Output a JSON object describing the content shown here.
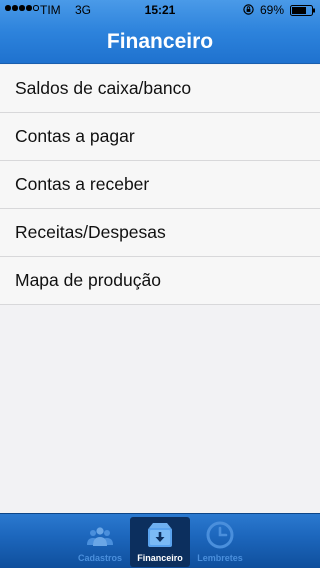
{
  "status_bar": {
    "carrier": "TIM",
    "network": "3G",
    "time": "15:21",
    "battery_percent": "69%",
    "signal_bars_filled": 4,
    "signal_bars_total": 5
  },
  "nav": {
    "title": "Financeiro"
  },
  "menu": {
    "items": [
      {
        "label": "Saldos de caixa/banco"
      },
      {
        "label": "Contas a pagar"
      },
      {
        "label": "Contas a receber"
      },
      {
        "label": "Receitas/Despesas"
      },
      {
        "label": "Mapa de produção"
      }
    ]
  },
  "tabbar": {
    "tabs": [
      {
        "label": "Cadastros",
        "icon": "people-icon",
        "active": false
      },
      {
        "label": "Financeiro",
        "icon": "download-box-icon",
        "active": true
      },
      {
        "label": "Lembretes",
        "icon": "clock-icon",
        "active": false
      }
    ]
  },
  "colors": {
    "nav_blue": "#2d83dc",
    "tab_inactive": "#4a8fdc",
    "tab_active_bg": "#0c2f5e"
  }
}
